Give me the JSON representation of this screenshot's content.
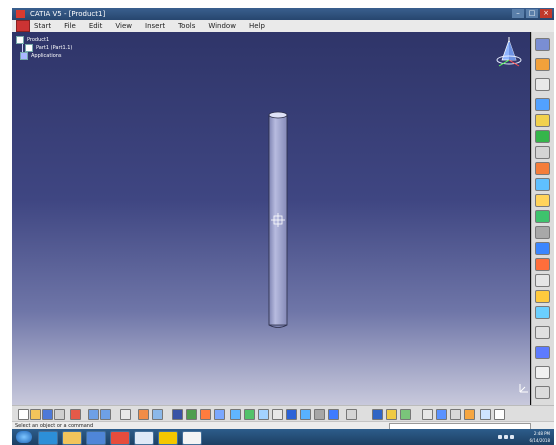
{
  "window": {
    "title": "CATIA V5 - [Product1]",
    "controls": [
      "–",
      "□",
      "×"
    ]
  },
  "menu": {
    "items": [
      "Start",
      "File",
      "Edit",
      "View",
      "Insert",
      "Tools",
      "Window",
      "Help"
    ]
  },
  "tree": {
    "root": "Product1",
    "child": "Part1 (Part1.1)",
    "applications": "Applications"
  },
  "status": {
    "prompt": "Select an object or a command",
    "command_input": ""
  },
  "taskbar": {
    "time": "2:48 PM",
    "date": "6/14/2018"
  },
  "colors": {
    "background_top": "#2f3569",
    "background_bottom": "#c8c9dc",
    "rod": "#9ea4cf"
  }
}
